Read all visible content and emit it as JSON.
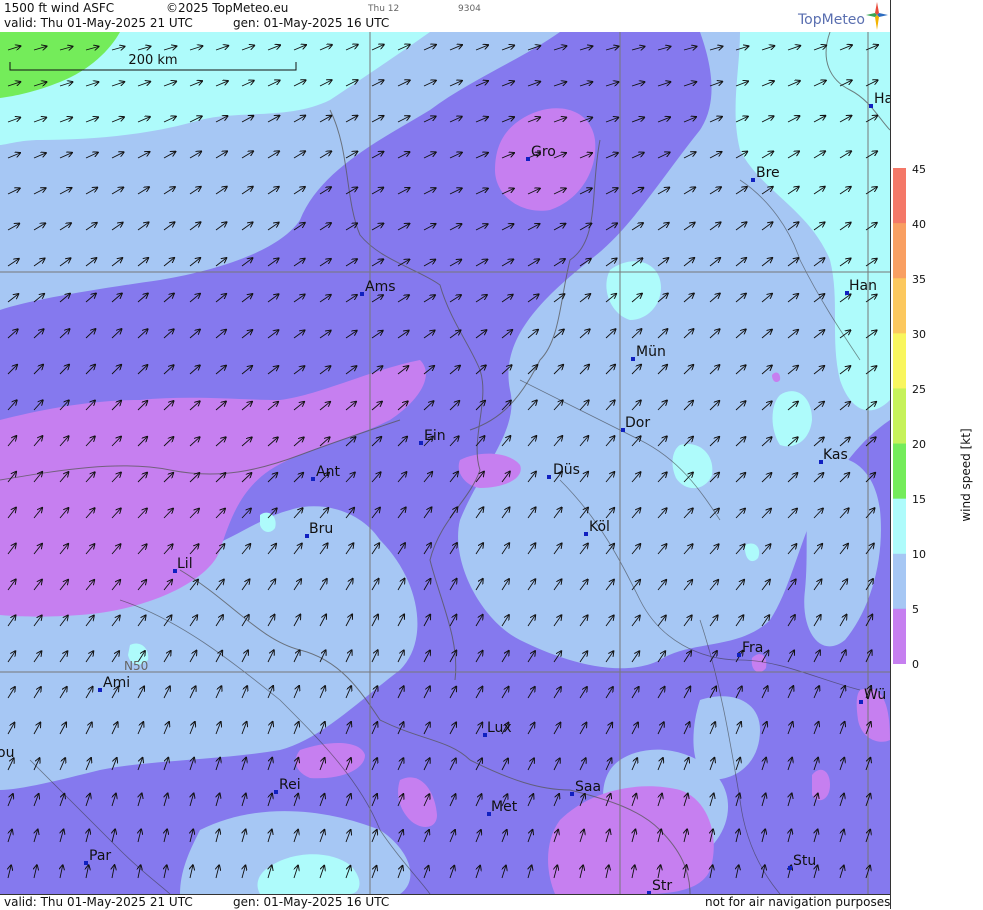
{
  "header": {
    "product": "1500 ft wind ASFC",
    "copyright": "©2025 TopMeteo.eu",
    "small1": "Thu 12",
    "small2": "9304",
    "valid": "valid:  Thu  01-May-2025  21 UTC",
    "gen": "gen: 01-May-2025 16 UTC",
    "logo": "TopMeteo"
  },
  "footer": {
    "valid": "valid:  Thu  01-May-2025  21 UTC",
    "gen": "gen: 01-May-2025 16 UTC",
    "disclaimer": "not for air navigation purposes"
  },
  "map": {
    "scale_label": "200 km",
    "lat_label": "N50",
    "cities": [
      {
        "name": "Gro"
      },
      {
        "name": "Bre"
      },
      {
        "name": "Ha"
      },
      {
        "name": "Ams"
      },
      {
        "name": "Han"
      },
      {
        "name": "Mün"
      },
      {
        "name": "Dor"
      },
      {
        "name": "Ein"
      },
      {
        "name": "Kas"
      },
      {
        "name": "Ant"
      },
      {
        "name": "Düs"
      },
      {
        "name": "Bru"
      },
      {
        "name": "Köl"
      },
      {
        "name": "Lil"
      },
      {
        "name": "Fra"
      },
      {
        "name": "Ami"
      },
      {
        "name": "Wü"
      },
      {
        "name": "Lux"
      },
      {
        "name": "ou"
      },
      {
        "name": "Rei"
      },
      {
        "name": "Saa"
      },
      {
        "name": "Met"
      },
      {
        "name": "Par"
      },
      {
        "name": "Stu"
      },
      {
        "name": "Str"
      }
    ]
  },
  "colorbar": {
    "title": "wind  speed  [kt]",
    "ticks": [
      "45",
      "40",
      "35",
      "30",
      "25",
      "20",
      "15",
      "10",
      "5",
      "0"
    ],
    "colors": [
      "#f47868",
      "#f99f62",
      "#fcc85e",
      "#f9f65e",
      "#c6f25a",
      "#74ec5a",
      "#aefbfb",
      "#a6c7f4",
      "#8579ee",
      "#c67ff0"
    ]
  },
  "colors": {
    "violet": "#8579ee",
    "light_blue": "#a6c7f4",
    "cyan": "#aefbfb",
    "purple": "#c67ff0",
    "green": "#74ec5a",
    "city_marker": "#1020c0"
  }
}
